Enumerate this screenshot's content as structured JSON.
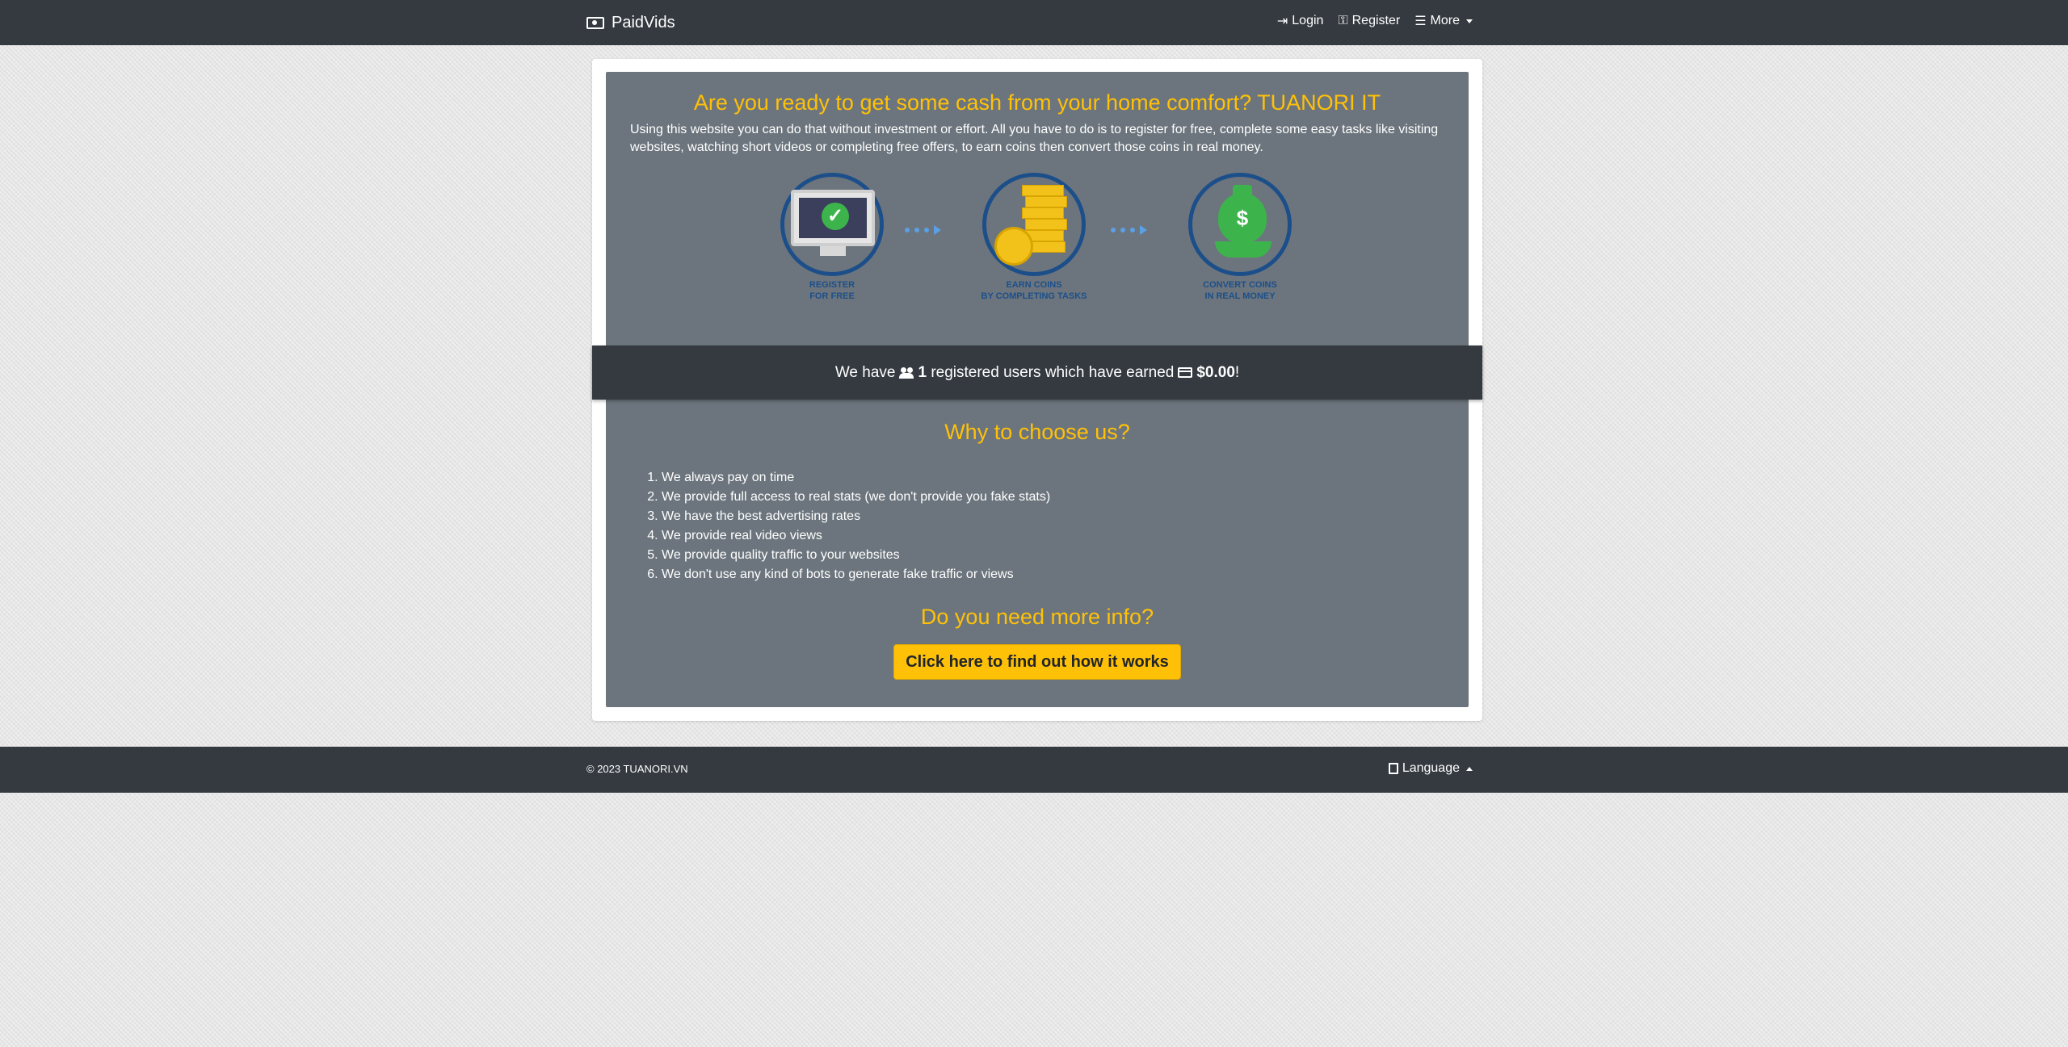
{
  "navbar": {
    "brand": "PaidVids",
    "brand_icon": "money-bill-icon",
    "login": "Login",
    "register": "Register",
    "more": "More"
  },
  "hero": {
    "title": "Are you ready to get some cash from your home comfort? TUANORI IT",
    "text": "Using this website you can do that without investment or effort. All you have to do is to register for free, complete some easy tasks like visiting websites, watching short videos or completing free offers, to earn coins then convert those coins in real money."
  },
  "steps": [
    {
      "line1": "REGISTER",
      "line2": "FOR FREE",
      "icon": "monitor-check-icon"
    },
    {
      "line1": "EARN COINS",
      "line2": "BY COMPLETING TASKS",
      "icon": "coins-icon"
    },
    {
      "line1": "CONVERT COINS",
      "line2": "IN REAL MONEY",
      "icon": "money-bag-icon"
    }
  ],
  "stats": {
    "prefix": "We have",
    "users": "1",
    "middle": "registered users which have earned",
    "earned": "$0.00",
    "suffix": "!"
  },
  "why": {
    "title": "Why to choose us?",
    "items": [
      "We always pay on time",
      "We provide full access to real stats (we don't provide you fake stats)",
      "We have the best advertising rates",
      "We provide real video views",
      "We provide quality traffic to your websites",
      "We don't use any kind of bots to generate fake traffic or views"
    ]
  },
  "more": {
    "title": "Do you need more info?",
    "button": "Click here to find out how it works"
  },
  "footer": {
    "copyright": "© 2023 TUANORI.VN",
    "language": "Language"
  },
  "colors": {
    "navbar": "#343a40",
    "panel": "#6c757d",
    "accent": "#ffc107",
    "step_blue": "#1c4f8a"
  }
}
